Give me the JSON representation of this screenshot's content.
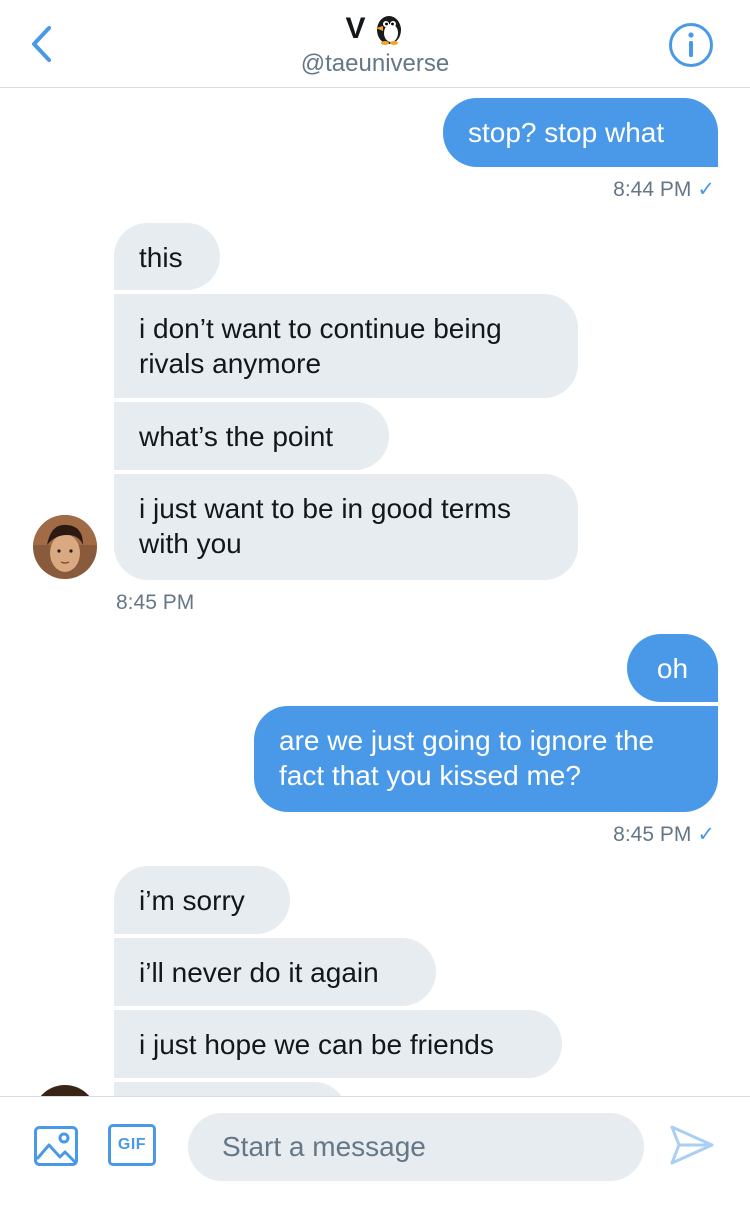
{
  "header": {
    "name": "V",
    "name_emoji": "penguin",
    "handle": "@taeuniverse",
    "back_icon": "chevron-left-icon",
    "info_icon": "info-icon"
  },
  "messages": [
    {
      "text": "stop? stop what"
    },
    {
      "time": "8:44 PM",
      "status": "✓"
    },
    {
      "text": "this"
    },
    {
      "text": "i don’t want to continue being rivals anymore"
    },
    {
      "text": "what’s the point"
    },
    {
      "text": "i just want to be in good terms with you"
    },
    {
      "time": "8:45 PM"
    },
    {
      "text": "oh"
    },
    {
      "text": "are we just going to ignore the fact that you kissed me?"
    },
    {
      "time": "8:45 PM",
      "status": "✓"
    },
    {
      "text": "i’m sorry"
    },
    {
      "text": "i’ll never do it again"
    },
    {
      "text": "i just hope we can be friends"
    }
  ],
  "composer": {
    "placeholder": "Start a message",
    "gif_label": "GIF",
    "media_icon": "image-icon",
    "send_icon": "send-icon"
  },
  "colors": {
    "accent": "#4a99e9",
    "incoming_bubble": "#e6ecf0",
    "secondary_text": "#657786",
    "border": "#d8dde1"
  }
}
